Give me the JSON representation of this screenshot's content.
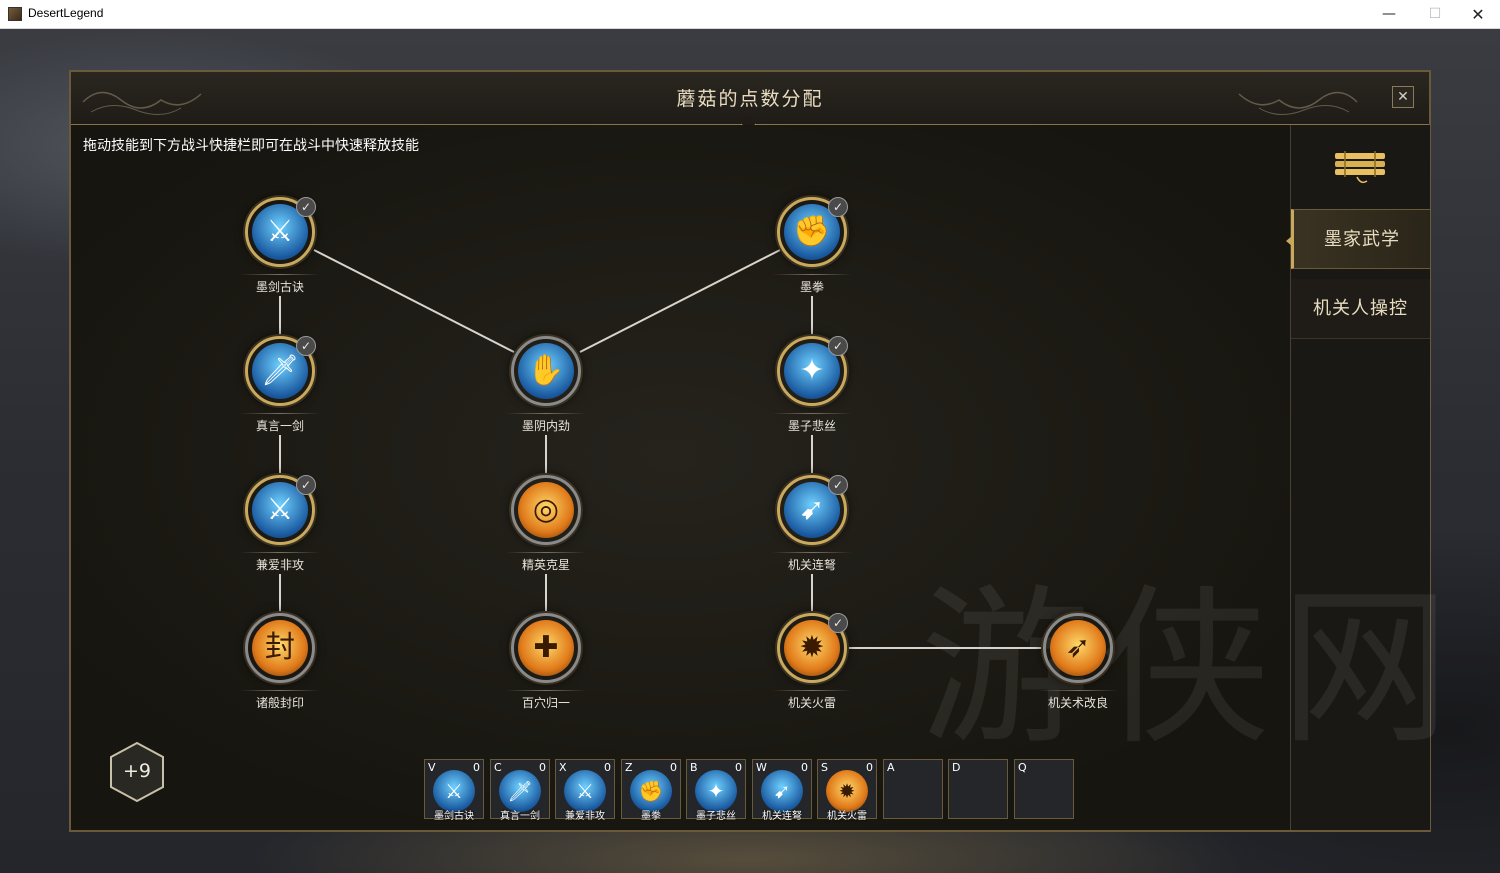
{
  "window": {
    "title": "DesertLegend",
    "minimize": "—",
    "maximize": "☐",
    "close": "✕"
  },
  "panel": {
    "title": "蘑菇的点数分配",
    "close_label": "✕",
    "hint": "拖动技能到下方战斗快捷栏即可在战斗中快速释放技能"
  },
  "sidebar": {
    "tabs": [
      {
        "label": "墨家武学",
        "active": true
      },
      {
        "label": "机关人操控",
        "active": false
      }
    ]
  },
  "skill_tree": {
    "nodes": [
      {
        "id": "moji",
        "label": "墨剑古诀",
        "learned": true,
        "style": "blue",
        "glyph": "⚔"
      },
      {
        "id": "zhenyan",
        "label": "真言一剑",
        "learned": true,
        "style": "blue",
        "glyph": "🗡"
      },
      {
        "id": "jianai",
        "label": "兼爱非攻",
        "learned": true,
        "style": "blue",
        "glyph": "⚔"
      },
      {
        "id": "zhuban",
        "label": "诸般封印",
        "learned": false,
        "style": "fire",
        "glyph": "封"
      },
      {
        "id": "moyin",
        "label": "墨阴内劲",
        "learned": false,
        "style": "blue",
        "glyph": "✋"
      },
      {
        "id": "jingying",
        "label": "精英克星",
        "learned": false,
        "style": "fire",
        "glyph": "◎"
      },
      {
        "id": "baixue",
        "label": "百穴归一",
        "learned": false,
        "style": "fire",
        "glyph": "✚"
      },
      {
        "id": "moquan",
        "label": "墨拳",
        "learned": true,
        "style": "blue",
        "glyph": "✊"
      },
      {
        "id": "mozi",
        "label": "墨子悲丝",
        "learned": true,
        "style": "blue",
        "glyph": "✦"
      },
      {
        "id": "lianu",
        "label": "机关连弩",
        "learned": true,
        "style": "blue",
        "glyph": "➹"
      },
      {
        "id": "huolei",
        "label": "机关火雷",
        "learned": true,
        "style": "fire",
        "glyph": "✹"
      },
      {
        "id": "gailiang",
        "label": "机关术改良",
        "learned": false,
        "style": "fire",
        "glyph": "➶"
      }
    ]
  },
  "points": {
    "value": "+9"
  },
  "quickbar": [
    {
      "key": "V",
      "count": "0",
      "name": "墨剑古诀",
      "style": "blue",
      "glyph": "⚔"
    },
    {
      "key": "C",
      "count": "0",
      "name": "真言一剑",
      "style": "blue",
      "glyph": "🗡"
    },
    {
      "key": "X",
      "count": "0",
      "name": "兼爱非攻",
      "style": "blue",
      "glyph": "⚔"
    },
    {
      "key": "Z",
      "count": "0",
      "name": "墨拳",
      "style": "blue",
      "glyph": "✊"
    },
    {
      "key": "B",
      "count": "0",
      "name": "墨子悲丝",
      "style": "blue",
      "glyph": "✦"
    },
    {
      "key": "W",
      "count": "0",
      "name": "机关连弩",
      "style": "blue",
      "glyph": "➹"
    },
    {
      "key": "S",
      "count": "0",
      "name": "机关火雷",
      "style": "fire",
      "glyph": "✹"
    },
    {
      "key": "A",
      "count": "",
      "name": "",
      "style": "",
      "glyph": ""
    },
    {
      "key": "D",
      "count": "",
      "name": "",
      "style": "",
      "glyph": ""
    },
    {
      "key": "Q",
      "count": "",
      "name": "",
      "style": "",
      "glyph": ""
    }
  ],
  "watermark": "游侠网",
  "colors": {
    "gold": "#c9a95c",
    "panel_bg": "#1c1a16",
    "skill_blue": "#3a9ae0",
    "skill_fire": "#e08a2a"
  }
}
